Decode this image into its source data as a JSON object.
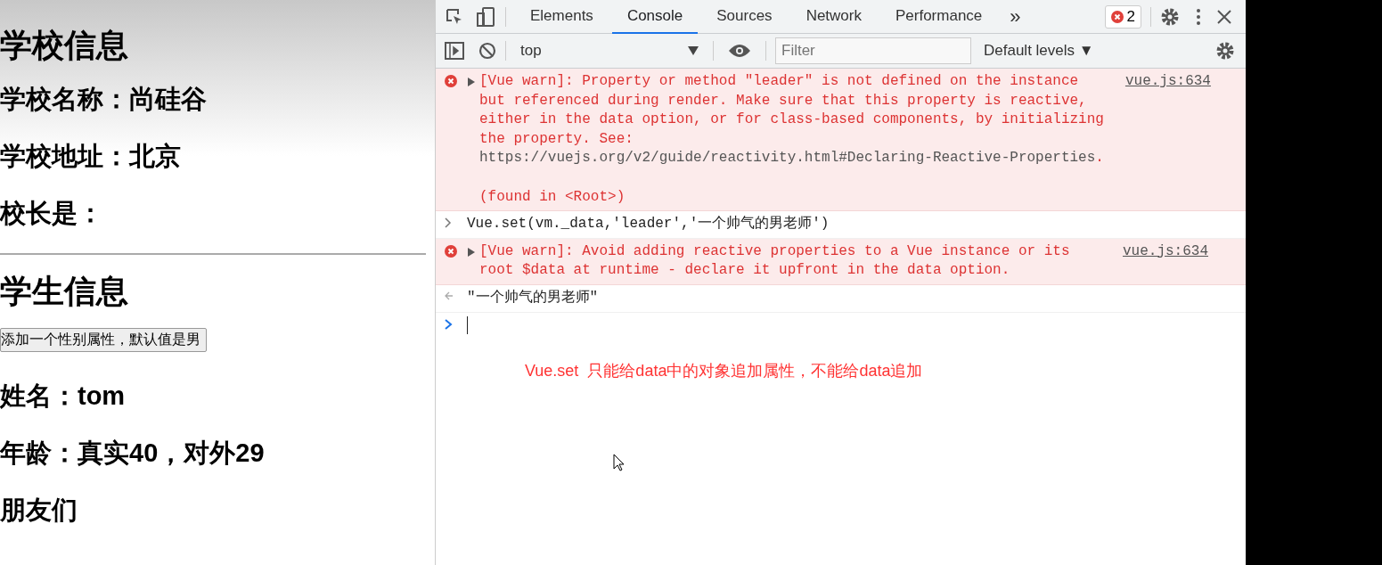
{
  "page": {
    "items": [
      {
        "kind": "heading",
        "text": "学校信息"
      },
      {
        "kind": "line",
        "text": "学校名称：尚硅谷"
      },
      {
        "kind": "line",
        "text": "学校地址：北京"
      },
      {
        "kind": "line",
        "text": "校长是："
      },
      {
        "kind": "rule"
      },
      {
        "kind": "heading",
        "text": "学生信息"
      },
      {
        "kind": "button",
        "text": "添加一个性别属性，默认值是男"
      },
      {
        "kind": "line",
        "text": "姓名：tom"
      },
      {
        "kind": "line",
        "text": "年龄：真实40，对外29"
      },
      {
        "kind": "line",
        "text": "朋友们"
      }
    ]
  },
  "devtools": {
    "tabs": [
      {
        "label": "Elements",
        "selected": false
      },
      {
        "label": "Console",
        "selected": true
      },
      {
        "label": "Sources",
        "selected": false
      },
      {
        "label": "Network",
        "selected": false
      },
      {
        "label": "Performance",
        "selected": false
      }
    ],
    "more": "»",
    "error_count": "2",
    "context": "top",
    "filter_placeholder": "Filter",
    "levels": "Default levels ▼"
  },
  "console": [
    {
      "kind": "error",
      "text": "[Vue warn]: Property or method \"leader\" is not defined on the instance but referenced during render. Make sure that this property is reactive, either in the data option, or for class-based components, by initializing the property. See: ",
      "link": "https://vuejs.org/v2/guide/reactivity.html#Declaring-Reactive-Properties",
      "after": ".",
      "detail": "(found in <Root>)",
      "source": "vue.js:634"
    },
    {
      "kind": "input",
      "text": "Vue.set(vm._data,'leader','一个帅气的男老师')"
    },
    {
      "kind": "error",
      "text": "[Vue warn]: Avoid adding reactive properties to a Vue instance or its root $data at runtime - declare it upfront in the data option.",
      "source": "vue.js:634"
    },
    {
      "kind": "result",
      "text": "\"一个帅气的男老师\""
    },
    {
      "kind": "prompt"
    }
  ],
  "annotation": "Vue.set  只能给data中的对象追加属性，不能给data追加"
}
